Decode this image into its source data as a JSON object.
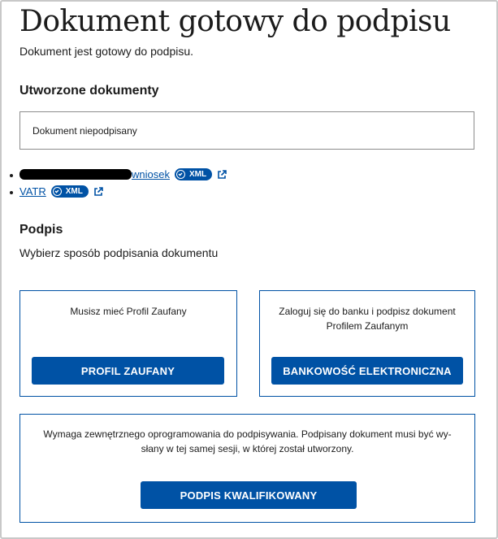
{
  "header": {
    "title": "Dokument gotowy do podpisu",
    "subtitle": "Dokument jest gotowy do podpisu."
  },
  "documents_section": {
    "heading": "Utworzone dokumenty",
    "status": "Dokument niepodpisany",
    "items": [
      {
        "name": "wniosek",
        "badge": "XML",
        "redacted": true
      },
      {
        "name": "VATR",
        "badge": "XML",
        "redacted": false
      }
    ]
  },
  "signature_section": {
    "heading": "Podpis",
    "instruction": "Wybierz sposób podpisania dokumentu",
    "options": [
      {
        "description": "Musisz mieć Profil Zaufany",
        "button": "PROFIL ZAUFANY"
      },
      {
        "description": "Zaloguj się do banku i podpisz dokument Profilem Zaufanym",
        "button": "BANKOWOŚĆ ELEKTRONICZNA"
      },
      {
        "description": "Wymaga zewnętrznego oprogramowania do podpisywania. Podpisany dokument musi być wy-słany w tej samej sesji, w której został utworzony.",
        "button": "PODPIS KWALIFIKOWANY"
      }
    ]
  },
  "colors": {
    "primary": "#0052a5",
    "border": "#8c8c8c",
    "text": "#1b1b1b"
  },
  "icons": [
    "download-icon",
    "external-link-icon"
  ]
}
